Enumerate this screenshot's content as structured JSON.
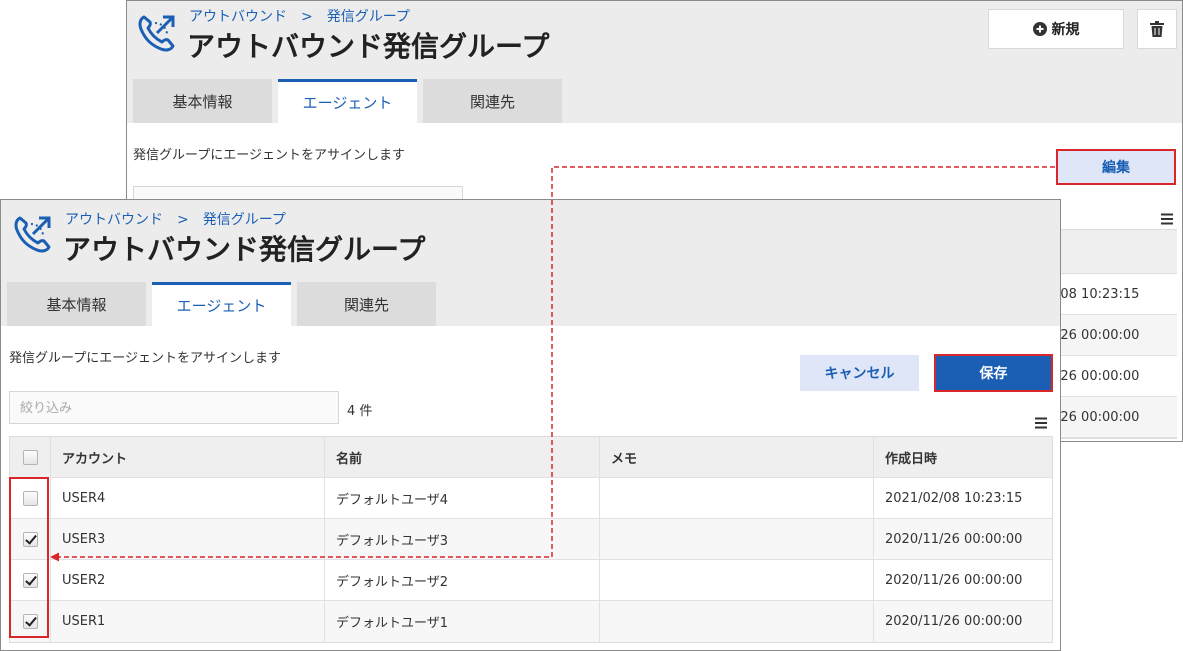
{
  "back_screen": {
    "breadcrumb": {
      "parent": "アウトバウンド",
      "separator": ">",
      "current": "発信グループ"
    },
    "title": "アウトバウンド発信グループ",
    "tabs": [
      {
        "label": "基本情報",
        "active": false
      },
      {
        "label": "エージェント",
        "active": true
      },
      {
        "label": "関連先",
        "active": false
      }
    ],
    "description": "発信グループにエージェントをアサインします",
    "new_button": "新規",
    "edit_button": "編集",
    "visible_dates": [
      "/08 10:23:15",
      "/26 00:00:00",
      "/26 00:00:00",
      "/26 00:00:00"
    ]
  },
  "front_screen": {
    "breadcrumb": {
      "parent": "アウトバウンド",
      "separator": ">",
      "current": "発信グループ"
    },
    "title": "アウトバウンド発信グループ",
    "tabs": [
      {
        "label": "基本情報",
        "active": false
      },
      {
        "label": "エージェント",
        "active": true
      },
      {
        "label": "関連先",
        "active": false
      }
    ],
    "description": "発信グループにエージェントをアサインします",
    "cancel_button": "キャンセル",
    "save_button": "保存",
    "filter": {
      "placeholder": "絞り込み",
      "value": ""
    },
    "count": {
      "value": "4",
      "unit": "件"
    },
    "table": {
      "columns": [
        "アカウント",
        "名前",
        "メモ",
        "作成日時"
      ],
      "rows": [
        {
          "account": "USER4",
          "name": "デフォルトユーザ4",
          "memo": "",
          "created": "2021/02/08 10:23:15",
          "checked": false
        },
        {
          "account": "USER3",
          "name": "デフォルトユーザ3",
          "memo": "",
          "created": "2020/11/26 00:00:00",
          "checked": true
        },
        {
          "account": "USER2",
          "name": "デフォルトユーザ2",
          "memo": "",
          "created": "2020/11/26 00:00:00",
          "checked": true
        },
        {
          "account": "USER1",
          "name": "デフォルトユーザ1",
          "memo": "",
          "created": "2020/11/26 00:00:00",
          "checked": true
        }
      ]
    }
  },
  "colors": {
    "accent": "#1a5fb4",
    "highlight": "#d9262b",
    "header_bg": "#ececec",
    "tab_bg": "#dcdcdc"
  },
  "icons": [
    "phone-outbound-icon",
    "plus-circle-icon",
    "trash-icon",
    "hamburger-menu-icon",
    "checkbox-icon"
  ]
}
